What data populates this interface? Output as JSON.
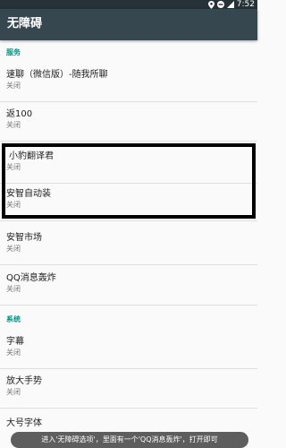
{
  "status_bar": {
    "time": "7:52",
    "icons": [
      "location-icon",
      "do-not-disturb-icon",
      "signal-icon"
    ]
  },
  "app_bar": {
    "title": "无障碍"
  },
  "sections": {
    "services_header": "服务",
    "system_header": "系统"
  },
  "services": [
    {
      "title": "速聊（微信版）-随我所聊",
      "summary": "关闭"
    },
    {
      "title": "返100",
      "summary": "关闭"
    },
    {
      "title": "小豹翻译君",
      "summary": "关闭"
    },
    {
      "title": "安智自动装",
      "summary": "关闭"
    },
    {
      "title": "安智市场",
      "summary": "关闭"
    },
    {
      "title": "QQ消息轰炸",
      "summary": "关闭"
    }
  ],
  "system": [
    {
      "title": "字幕",
      "summary": "关闭"
    },
    {
      "title": "放大手势",
      "summary": "关闭"
    },
    {
      "title": "大号字体",
      "summary": ""
    }
  ],
  "toast": {
    "text": "进入'无障碍选项'，里面有一个'QQ消息轰炸'，打开即可"
  },
  "colors": {
    "app_bar": "#37474f",
    "status_bar": "#263238",
    "section_header": "#009688",
    "highlight_border": "#000000"
  }
}
